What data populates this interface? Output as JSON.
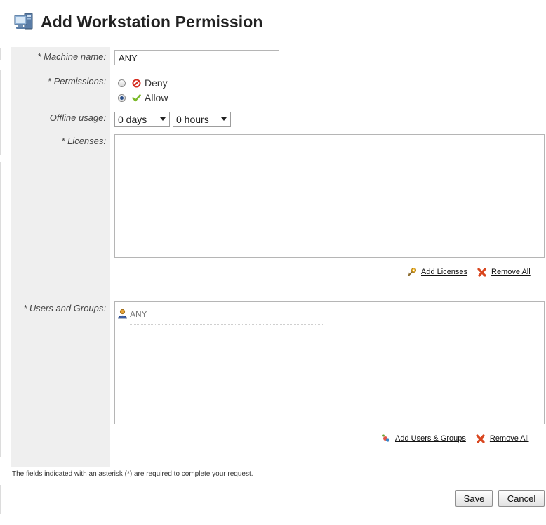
{
  "page": {
    "title": "Add Workstation Permission"
  },
  "form": {
    "machine_name": {
      "label": "* Machine name:",
      "value": "ANY"
    },
    "permissions": {
      "label": "* Permissions:",
      "options": [
        {
          "label": "Deny",
          "icon": "deny-icon",
          "selected": false
        },
        {
          "label": "Allow",
          "icon": "check-icon",
          "selected": true
        }
      ]
    },
    "offline_usage": {
      "label": "Offline usage:",
      "days": "0 days",
      "hours": "0 hours"
    },
    "licenses": {
      "label": "* Licenses:",
      "add_label": "Add Licenses",
      "remove_label": "Remove All"
    },
    "users_groups": {
      "label": "* Users and Groups:",
      "items": [
        {
          "name": "ANY",
          "icon": "user-icon"
        }
      ],
      "add_label": "Add Users & Groups",
      "remove_label": "Remove All"
    }
  },
  "footer": {
    "note": "The fields indicated with an asterisk (*) are required to complete your request.",
    "save_label": "Save",
    "cancel_label": "Cancel"
  },
  "colors": {
    "deny": "#d52b1e",
    "allow": "#7ab929",
    "label_bg": "#efefef"
  }
}
